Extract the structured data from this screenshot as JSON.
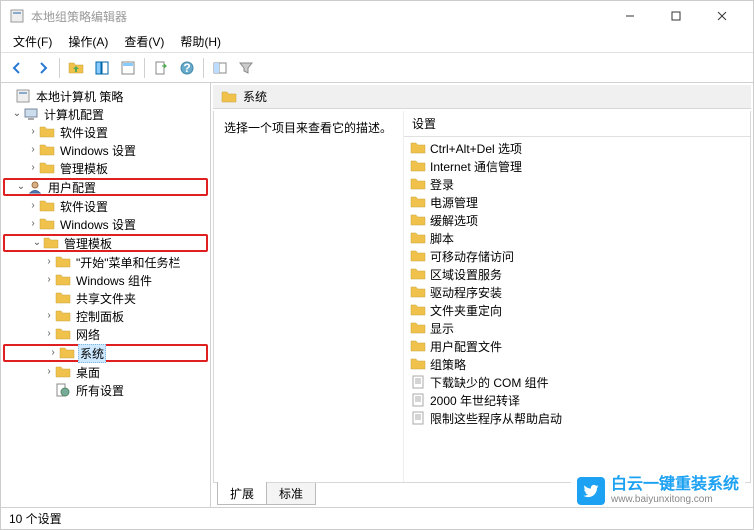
{
  "window": {
    "title": "本地组策略编辑器"
  },
  "menu": {
    "file": "文件(F)",
    "action": "操作(A)",
    "view": "查看(V)",
    "help": "帮助(H)"
  },
  "tree": {
    "root": "本地计算机 策略",
    "computer_config": "计算机配置",
    "cc_software": "软件设置",
    "cc_windows": "Windows 设置",
    "cc_admin": "管理模板",
    "user_config": "用户配置",
    "uc_software": "软件设置",
    "uc_windows": "Windows 设置",
    "uc_admin": "管理模板",
    "start_menu": "\"开始\"菜单和任务栏",
    "win_components": "Windows 组件",
    "shared_folders": "共享文件夹",
    "control_panel": "控制面板",
    "network": "网络",
    "system": "系统",
    "desktop": "桌面",
    "all_settings": "所有设置"
  },
  "path": {
    "current": "系统"
  },
  "desc": {
    "prompt": "选择一个项目来查看它的描述。"
  },
  "list": {
    "header": "设置",
    "items": [
      {
        "t": "folder",
        "l": "Ctrl+Alt+Del 选项"
      },
      {
        "t": "folder",
        "l": "Internet 通信管理"
      },
      {
        "t": "folder",
        "l": "登录"
      },
      {
        "t": "folder",
        "l": "电源管理"
      },
      {
        "t": "folder",
        "l": "缓解选项"
      },
      {
        "t": "folder",
        "l": "脚本"
      },
      {
        "t": "folder",
        "l": "可移动存储访问"
      },
      {
        "t": "folder",
        "l": "区域设置服务"
      },
      {
        "t": "folder",
        "l": "驱动程序安装"
      },
      {
        "t": "folder",
        "l": "文件夹重定向"
      },
      {
        "t": "folder",
        "l": "显示"
      },
      {
        "t": "folder",
        "l": "用户配置文件"
      },
      {
        "t": "folder",
        "l": "组策略"
      },
      {
        "t": "setting",
        "l": "下载缺少的 COM 组件"
      },
      {
        "t": "setting",
        "l": "2000 年世纪转译"
      },
      {
        "t": "setting",
        "l": "限制这些程序从帮助启动"
      }
    ]
  },
  "tabs": {
    "extended": "扩展",
    "standard": "标准"
  },
  "status": {
    "text": "10 个设置"
  },
  "watermark": {
    "main": "白云一键重装系统",
    "sub": "www.baiyunxitong.com"
  }
}
